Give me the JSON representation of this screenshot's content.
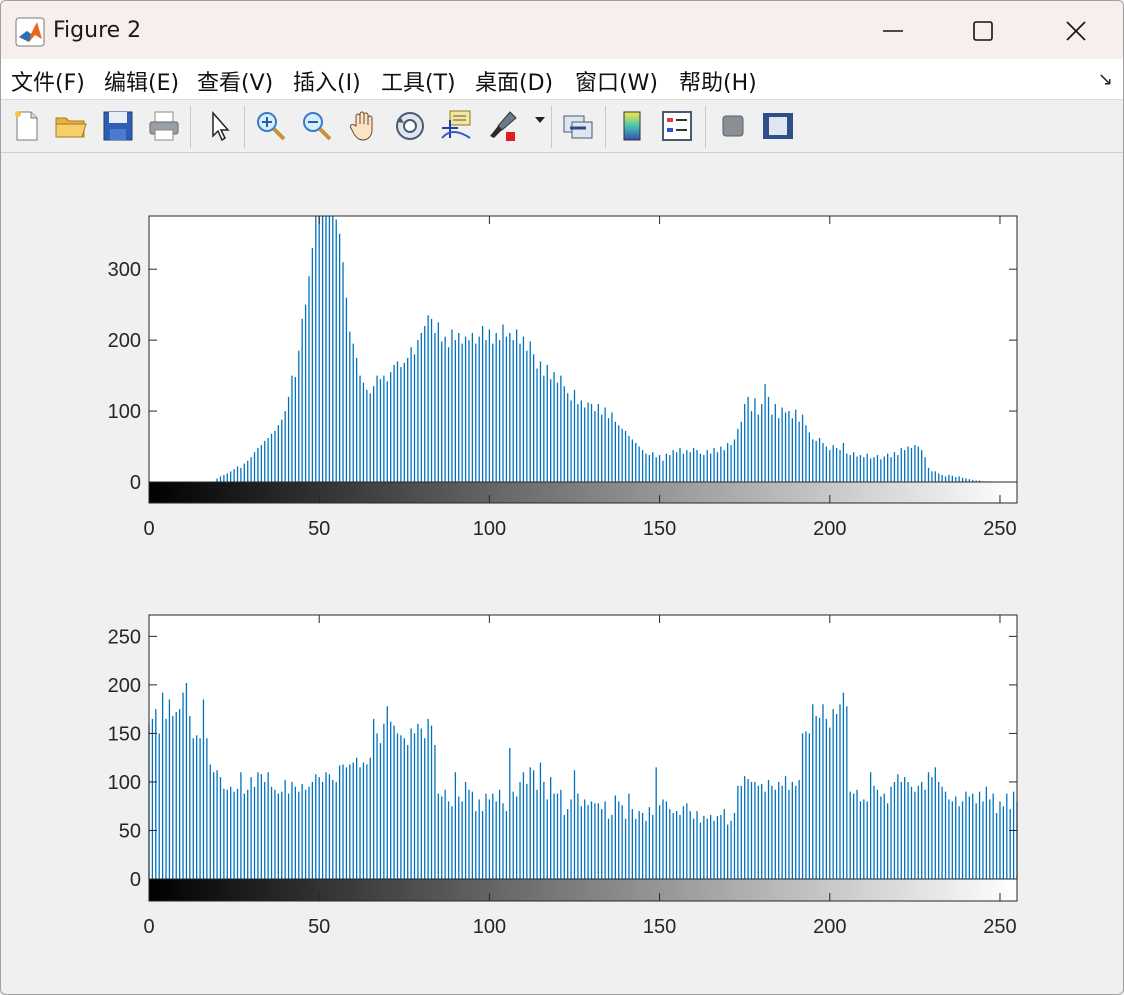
{
  "window": {
    "title": "Figure 2",
    "icon": "matlab-logo-icon",
    "controls": [
      "minimize-icon",
      "maximize-icon",
      "close-icon"
    ]
  },
  "menubar": {
    "items": [
      "文件(F)",
      "编辑(E)",
      "查看(V)",
      "插入(I)",
      "工具(T)",
      "桌面(D)",
      "窗口(W)",
      "帮助(H)"
    ],
    "overflow_icon": "dock-arrow-icon"
  },
  "toolbar": {
    "items": [
      "new-file-icon",
      "open-folder-icon",
      "save-icon",
      "print-icon",
      "select-arrow-icon",
      "zoom-in-icon",
      "zoom-out-icon",
      "pan-hand-icon",
      "rotate-3d-icon",
      "data-cursor-icon",
      "brush-icon",
      "link-plot-icon",
      "colorbar-icon",
      "legend-icon",
      "hide-plot-tools-icon",
      "show-plot-tools-icon"
    ]
  },
  "colors": {
    "bar": "#0072bd",
    "axes": "#262626",
    "background": "#f0f0f0"
  },
  "chart_data": [
    {
      "type": "bar",
      "title": "",
      "xlabel": "",
      "ylabel": "",
      "xlim": [
        0,
        255
      ],
      "ylim": [
        0,
        375
      ],
      "yticks": [
        0,
        100,
        200,
        300
      ],
      "xticks": [
        0,
        50,
        100,
        150,
        200,
        250
      ],
      "colorbar": "grayscale 0-255 below axis",
      "grid": false,
      "values": [
        0,
        0,
        0,
        0,
        0,
        0,
        0,
        0,
        0,
        0,
        0,
        0,
        0,
        0,
        0,
        0,
        0,
        0,
        0,
        0,
        5,
        8,
        10,
        12,
        15,
        18,
        22,
        20,
        26,
        30,
        35,
        42,
        48,
        52,
        58,
        62,
        68,
        72,
        80,
        88,
        100,
        120,
        150,
        148,
        185,
        230,
        250,
        290,
        330,
        375,
        375,
        375,
        375,
        375,
        375,
        370,
        350,
        310,
        260,
        212,
        195,
        175,
        150,
        140,
        130,
        125,
        135,
        150,
        145,
        150,
        142,
        155,
        165,
        170,
        162,
        168,
        175,
        190,
        180,
        200,
        210,
        220,
        235,
        230,
        210,
        225,
        198,
        205,
        190,
        215,
        200,
        210,
        195,
        205,
        200,
        210,
        195,
        205,
        220,
        200,
        215,
        195,
        210,
        200,
        222,
        205,
        210,
        200,
        215,
        195,
        205,
        185,
        198,
        180,
        160,
        170,
        150,
        165,
        145,
        155,
        140,
        150,
        135,
        125,
        115,
        130,
        110,
        115,
        105,
        112,
        110,
        100,
        110,
        95,
        105,
        90,
        98,
        85,
        80,
        75,
        72,
        65,
        60,
        55,
        50,
        45,
        40,
        38,
        42,
        35,
        38,
        30,
        40,
        38,
        45,
        42,
        48,
        40,
        45,
        42,
        48,
        45,
        40,
        38,
        45,
        40,
        48,
        42,
        50,
        45,
        55,
        52,
        60,
        75,
        85,
        110,
        120,
        100,
        118,
        95,
        110,
        138,
        120,
        95,
        110,
        90,
        105,
        98,
        100,
        90,
        102,
        85,
        95,
        80,
        70,
        60,
        58,
        62,
        55,
        50,
        45,
        52,
        48,
        45,
        55,
        40,
        38,
        42,
        36,
        38,
        35,
        40,
        33,
        35,
        38,
        32,
        36,
        40,
        35,
        42,
        38,
        48,
        45,
        50,
        48,
        52,
        50,
        45,
        35,
        20,
        15,
        15,
        12,
        10,
        8,
        10,
        9,
        7,
        8,
        6,
        5,
        4,
        3,
        2,
        2,
        1,
        1,
        1,
        0,
        0,
        0,
        0,
        0
      ]
    },
    {
      "type": "bar",
      "title": "",
      "xlabel": "",
      "ylabel": "",
      "xlim": [
        0,
        255
      ],
      "ylim": [
        0,
        272
      ],
      "yticks": [
        0,
        50,
        100,
        150,
        200,
        250
      ],
      "xticks": [
        0,
        50,
        100,
        150,
        200,
        250
      ],
      "colorbar": "grayscale 0-255 below axis",
      "grid": false,
      "values": [
        160,
        165,
        175,
        150,
        192,
        165,
        185,
        168,
        172,
        175,
        192,
        202,
        168,
        145,
        148,
        145,
        185,
        145,
        118,
        110,
        112,
        105,
        93,
        92,
        95,
        90,
        93,
        110,
        88,
        92,
        105,
        95,
        110,
        108,
        100,
        110,
        95,
        92,
        88,
        90,
        102,
        88,
        100,
        95,
        90,
        98,
        92,
        95,
        100,
        108,
        105,
        100,
        110,
        108,
        102,
        100,
        117,
        118,
        115,
        118,
        120,
        125,
        115,
        120,
        118,
        125,
        165,
        150,
        140,
        160,
        178,
        162,
        158,
        150,
        148,
        145,
        138,
        155,
        150,
        160,
        155,
        145,
        165,
        158,
        138,
        88,
        85,
        92,
        80,
        75,
        110,
        85,
        80,
        100,
        92,
        90,
        70,
        82,
        70,
        88,
        82,
        88,
        80,
        92,
        78,
        70,
        135,
        90,
        85,
        100,
        110,
        98,
        115,
        112,
        92,
        120,
        100,
        82,
        105,
        88,
        88,
        92,
        66,
        72,
        82,
        112,
        88,
        75,
        82,
        76,
        80,
        78,
        78,
        72,
        80,
        62,
        66,
        86,
        80,
        76,
        62,
        88,
        72,
        62,
        70,
        68,
        60,
        74,
        66,
        115,
        76,
        82,
        80,
        72,
        68,
        70,
        66,
        75,
        78,
        70,
        62,
        70,
        58,
        65,
        62,
        66,
        60,
        65,
        66,
        72,
        56,
        60,
        68,
        96,
        96,
        106,
        103,
        100,
        100,
        96,
        98,
        90,
        102,
        96,
        92,
        100,
        96,
        106,
        92,
        100,
        96,
        102,
        150,
        152,
        150,
        180,
        168,
        166,
        180,
        165,
        156,
        175,
        170,
        180,
        192,
        178,
        90,
        88,
        92,
        80,
        82,
        80,
        110,
        96,
        92,
        85,
        88,
        78,
        95,
        100,
        108,
        100,
        105,
        100,
        95,
        90,
        96,
        100,
        92,
        110,
        105,
        115,
        100,
        95,
        90,
        82,
        80,
        85,
        75,
        80,
        90,
        85,
        88,
        78,
        90,
        80,
        95,
        82,
        88,
        68,
        80,
        75,
        88,
        72,
        90,
        80
      ]
    }
  ]
}
